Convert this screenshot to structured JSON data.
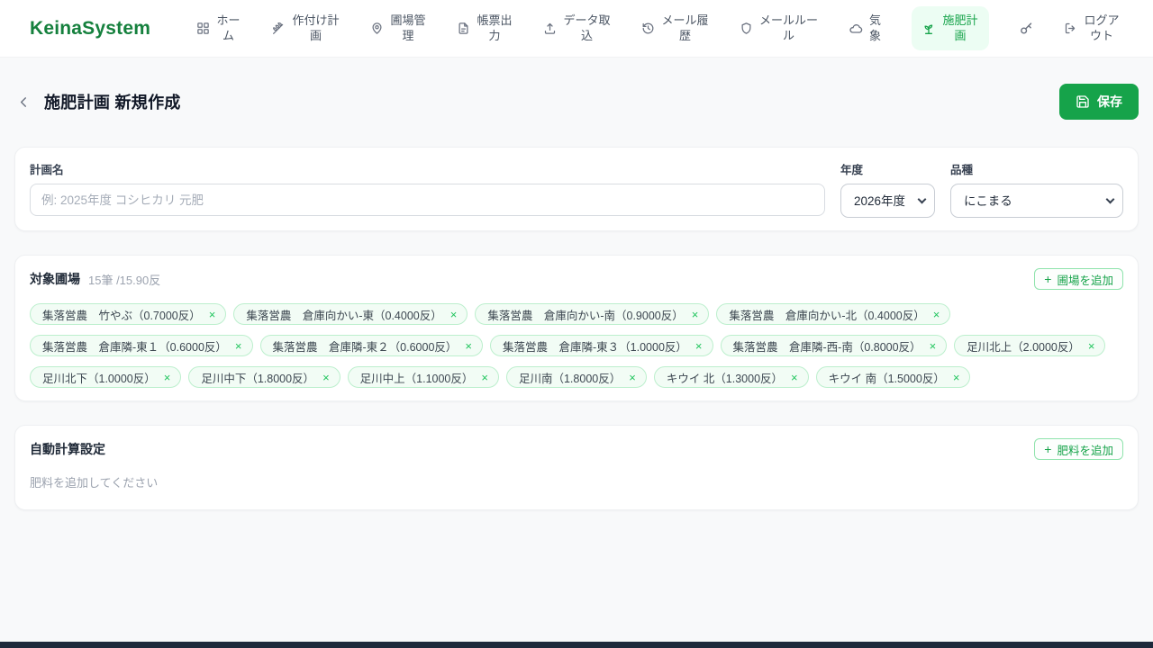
{
  "nav": {
    "logo": "KeinaSystem",
    "items": [
      {
        "label": "ホーム"
      },
      {
        "label": "作付け計画"
      },
      {
        "label": "圃場管理"
      },
      {
        "label": "帳票出力"
      },
      {
        "label": "データ取込"
      },
      {
        "label": "メール履歴"
      },
      {
        "label": "メールルール"
      },
      {
        "label": "気象"
      },
      {
        "label": "施肥計画"
      },
      {
        "label": "ログアウト"
      }
    ]
  },
  "header": {
    "title": "施肥計画 新規作成",
    "save_label": "保存"
  },
  "plan_form": {
    "name_label": "計画名",
    "name_placeholder": "例: 2025年度 コシヒカリ 元肥",
    "name_value": "",
    "year_label": "年度",
    "year_value": "2026年度",
    "variety_label": "品種",
    "variety_value": "にこまる"
  },
  "fields_section": {
    "title": "対象圃場",
    "count": "15筆 /15.90反",
    "add_button_label": "圃場を追加",
    "plus_glyph": "+",
    "remove_glyph": "×",
    "chips": [
      {
        "label": "集落営農　竹やぶ（0.7000反）"
      },
      {
        "label": "集落営農　倉庫向かい-東（0.4000反）"
      },
      {
        "label": "集落営農　倉庫向かい-南（0.9000反）"
      },
      {
        "label": "集落営農　倉庫向かい-北（0.4000反）"
      },
      {
        "label": "集落営農　倉庫隣-東１（0.6000反）"
      },
      {
        "label": "集落営農　倉庫隣-東２（0.6000反）"
      },
      {
        "label": "集落営農　倉庫隣-東３（1.0000反）"
      },
      {
        "label": "集落営農　倉庫隣-西-南（0.8000反）"
      },
      {
        "label": "足川北上（2.0000反）"
      },
      {
        "label": "足川北下（1.0000反）"
      },
      {
        "label": "足川中下（1.8000反）"
      },
      {
        "label": "足川中上（1.1000反）"
      },
      {
        "label": "足川南（1.8000反）"
      },
      {
        "label": "キウイ 北（1.3000反）"
      },
      {
        "label": "キウイ 南（1.5000反）"
      }
    ]
  },
  "auto_calc_section": {
    "title": "自動計算設定",
    "add_button_label": "肥料を追加",
    "plus_glyph": "+",
    "empty_text": "肥料を追加してください"
  },
  "colors": {
    "primary_green": "#16a34a",
    "logo_green": "#15803d",
    "active_nav_bg": "#ecfdf3",
    "chip_bg": "#f2fcf5",
    "chip_border": "#bcefcd",
    "bottom_bar": "#1e293b"
  }
}
